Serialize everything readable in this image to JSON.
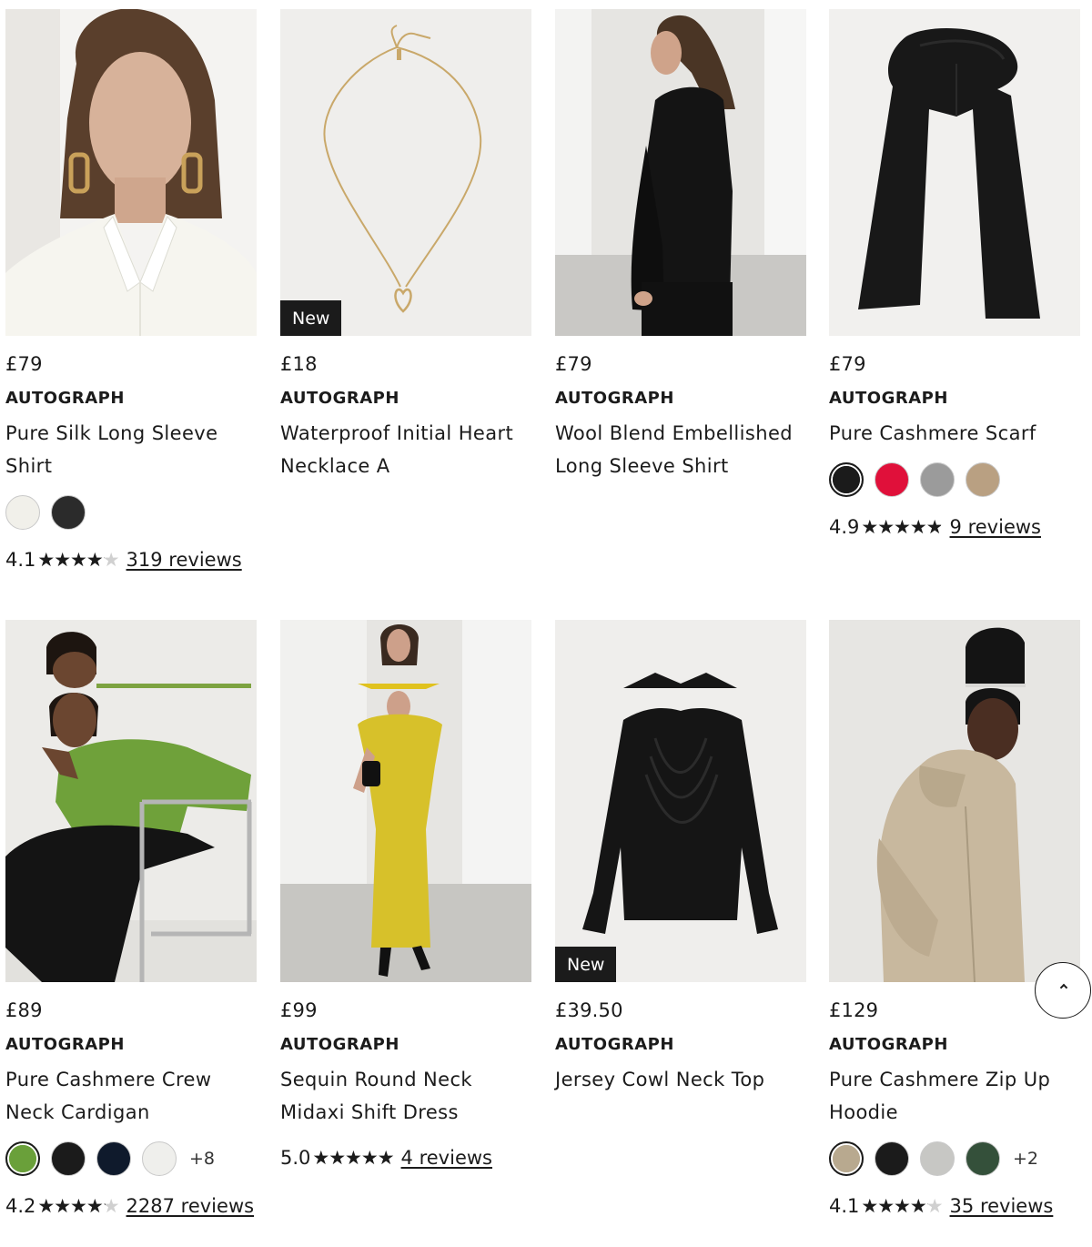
{
  "products": [
    {
      "price": "£79",
      "brand": "AUTOGRAPH",
      "name": "Pure Silk Long Sleeve Shirt",
      "image": "model-white-silk-shirt-gold-earrings",
      "badge": "",
      "swatches": [
        {
          "color": "#f1f0ea",
          "selected": false
        },
        {
          "color": "#2b2b2b",
          "selected": false
        }
      ],
      "more_colors": "",
      "rating": "4.1",
      "rating_value": 4.1,
      "reviews": "319 reviews"
    },
    {
      "price": "£18",
      "brand": "AUTOGRAPH",
      "name": "Waterproof Initial Heart Necklace A",
      "image": "gold-chain-necklace-heart-pendant",
      "badge": "New",
      "swatches": [],
      "more_colors": "",
      "rating": "",
      "rating_value": null,
      "reviews": ""
    },
    {
      "price": "£79",
      "brand": "AUTOGRAPH",
      "name": "Wool Blend Embellished Long Sleeve Shirt",
      "image": "model-profile-black-shirt",
      "badge": "",
      "swatches": [],
      "more_colors": "",
      "rating": "",
      "rating_value": null,
      "reviews": ""
    },
    {
      "price": "£79",
      "brand": "AUTOGRAPH",
      "name": "Pure Cashmere Scarf",
      "image": "black-cashmere-scarf",
      "badge": "",
      "swatches": [
        {
          "color": "#1b1b1b",
          "selected": true
        },
        {
          "color": "#e0103a",
          "selected": false
        },
        {
          "color": "#9b9b9b",
          "selected": false
        },
        {
          "color": "#b9a082",
          "selected": false
        }
      ],
      "more_colors": "",
      "rating": "4.9",
      "rating_value": 4.9,
      "reviews": "9 reviews"
    },
    {
      "price": "£89",
      "brand": "AUTOGRAPH",
      "name": "Pure Cashmere Crew Neck Cardigan",
      "image": "model-green-cardigan-on-chair",
      "badge": "",
      "swatches": [
        {
          "color": "#6aa03a",
          "selected": true
        },
        {
          "color": "#1b1b1b",
          "selected": false
        },
        {
          "color": "#0f1a2c",
          "selected": false
        },
        {
          "color": "#efefec",
          "selected": false
        }
      ],
      "more_colors": "+8",
      "rating": "4.2",
      "rating_value": 4.2,
      "reviews": "2287 reviews"
    },
    {
      "price": "£99",
      "brand": "AUTOGRAPH",
      "name": "Sequin Round Neck Midaxi Shift Dress",
      "image": "model-yellow-sequin-dress",
      "badge": "",
      "swatches": [],
      "more_colors": "",
      "rating": "5.0",
      "rating_value": 5.0,
      "reviews": "4 reviews"
    },
    {
      "price": "£39.50",
      "brand": "AUTOGRAPH",
      "name": "Jersey Cowl Neck Top",
      "image": "black-cowl-neck-top-flat",
      "badge": "New",
      "swatches": [],
      "more_colors": "",
      "rating": "",
      "rating_value": null,
      "reviews": ""
    },
    {
      "price": "£129",
      "brand": "AUTOGRAPH",
      "name": "Pure Cashmere Zip Up Hoodie",
      "image": "model-oatmeal-cashmere-hoodie",
      "badge": "",
      "swatches": [
        {
          "color": "#b8a98f",
          "selected": true
        },
        {
          "color": "#1b1b1b",
          "selected": false
        },
        {
          "color": "#c7c7c4",
          "selected": false
        },
        {
          "color": "#34503a",
          "selected": false
        }
      ],
      "more_colors": "+2",
      "rating": "4.1",
      "rating_value": 4.1,
      "reviews": "35 reviews"
    }
  ],
  "scroll_top_icon": "chevron-up-icon"
}
